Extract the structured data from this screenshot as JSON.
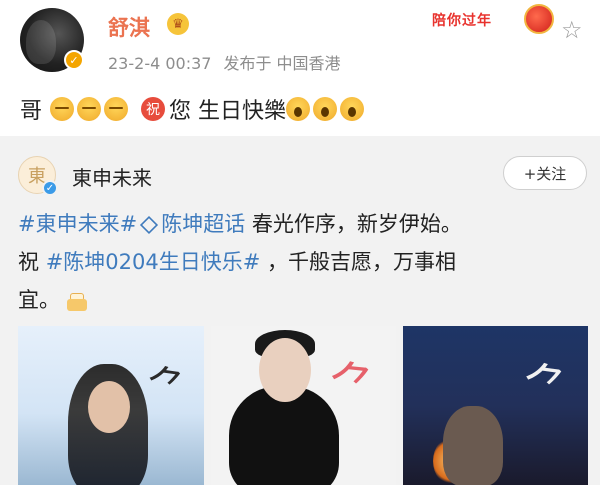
{
  "post": {
    "username": "舒淇",
    "date": "23-2-4 00:37",
    "source": "发布于 中国香港",
    "badge_text": "陪你过年",
    "text_prefix": "哥",
    "text_main": "您 生日快樂"
  },
  "repost": {
    "name": "東申未来",
    "follow_label": "+关注",
    "line1_tag1": "#東申未来#",
    "line1_tag2": "陈坤超话",
    "line1_text": " 春光作序，新岁伊始。",
    "line2_prefix": "祝 ",
    "line2_tag": "#陈坤0204生日快乐#",
    "line2_text": " ，千般吉愿，万事相",
    "line3_text": "宜。"
  },
  "icons": {
    "verified_badge_color": "#f4a500",
    "repost_verified_color": "#3b9be8",
    "star": "star-icon",
    "crown": "crown-icon"
  },
  "colors": {
    "username": "#eb7350",
    "tag": "#3f7bbd",
    "badge": "#e8322d"
  }
}
